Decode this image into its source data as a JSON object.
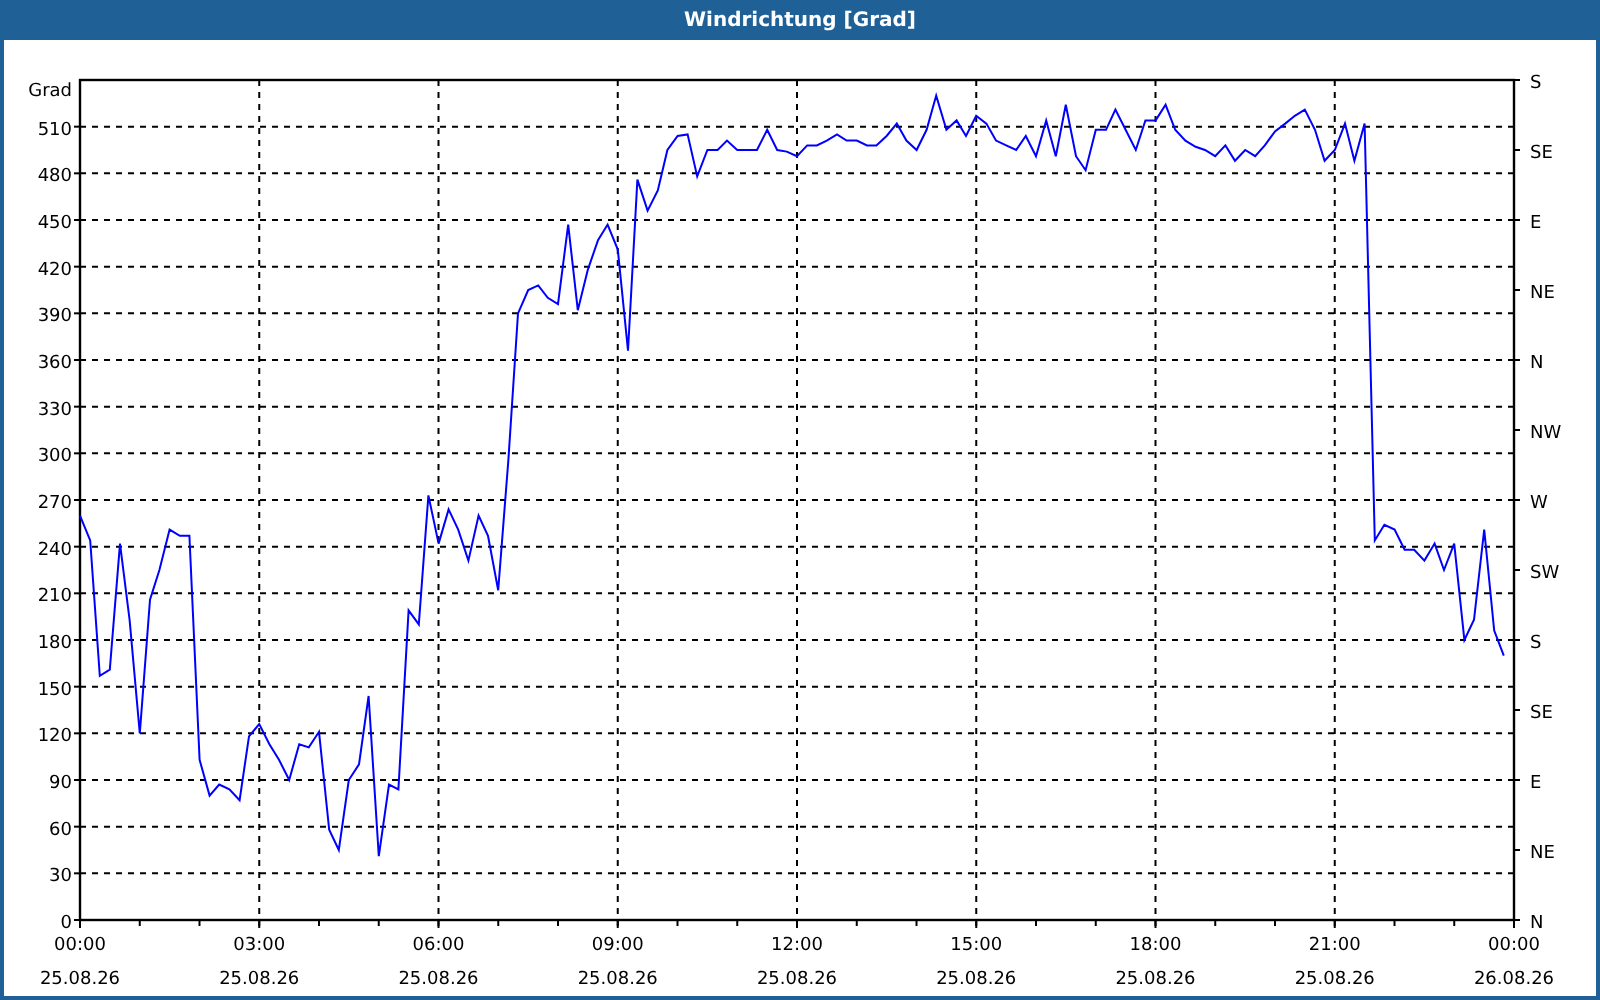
{
  "window": {
    "title": "Windrichtung [Grad]"
  },
  "compass_axis": [
    "S",
    "SE",
    "E",
    "NE",
    "N",
    "NW",
    "W",
    "SW",
    "S",
    "SE",
    "E",
    "NE",
    "N"
  ],
  "x_axis_dates": [
    "25.08.26",
    "25.08.26",
    "25.08.26",
    "25.08.26",
    "25.08.26",
    "25.08.26",
    "25.08.26",
    "25.08.26",
    "26.08.26"
  ],
  "chart_data": {
    "type": "line",
    "ylabel": "Grad",
    "xlim": [
      0,
      24
    ],
    "ylim": [
      0,
      540
    ],
    "grid": true,
    "yticks": [
      0,
      30,
      60,
      90,
      120,
      150,
      180,
      210,
      240,
      270,
      300,
      330,
      360,
      390,
      420,
      450,
      480,
      510
    ],
    "xticks": [
      {
        "value": 0,
        "label": "00:00"
      },
      {
        "value": 3,
        "label": "03:00"
      },
      {
        "value": 6,
        "label": "06:00"
      },
      {
        "value": 9,
        "label": "09:00"
      },
      {
        "value": 12,
        "label": "12:00"
      },
      {
        "value": 15,
        "label": "15:00"
      },
      {
        "value": 18,
        "label": "18:00"
      },
      {
        "value": 21,
        "label": "21:00"
      },
      {
        "value": 24,
        "label": "00:00"
      }
    ],
    "x": [
      0,
      0.17,
      0.33,
      0.5,
      0.67,
      0.83,
      1,
      1.17,
      1.33,
      1.5,
      1.67,
      1.83,
      2,
      2.17,
      2.33,
      2.5,
      2.67,
      2.83,
      3,
      3.17,
      3.33,
      3.5,
      3.67,
      3.83,
      4,
      4.17,
      4.33,
      4.5,
      4.67,
      4.83,
      5,
      5.17,
      5.33,
      5.5,
      5.67,
      5.83,
      6,
      6.17,
      6.33,
      6.5,
      6.67,
      6.83,
      7,
      7.17,
      7.33,
      7.5,
      7.67,
      7.83,
      8,
      8.17,
      8.33,
      8.5,
      8.67,
      8.83,
      9,
      9.17,
      9.33,
      9.5,
      9.67,
      9.83,
      10,
      10.17,
      10.33,
      10.5,
      10.67,
      10.83,
      11,
      11.17,
      11.33,
      11.5,
      11.67,
      11.83,
      12,
      12.17,
      12.33,
      12.5,
      12.67,
      12.83,
      13,
      13.17,
      13.33,
      13.5,
      13.67,
      13.83,
      14,
      14.17,
      14.33,
      14.5,
      14.67,
      14.83,
      15,
      15.17,
      15.33,
      15.5,
      15.67,
      15.83,
      16,
      16.17,
      16.33,
      16.5,
      16.67,
      16.83,
      17,
      17.17,
      17.33,
      17.5,
      17.67,
      17.83,
      18,
      18.17,
      18.33,
      18.5,
      18.67,
      18.83,
      19,
      19.17,
      19.33,
      19.5,
      19.67,
      19.83,
      20,
      20.17,
      20.33,
      20.5,
      20.67,
      20.83,
      21,
      21.17,
      21.33,
      21.5,
      21.67,
      21.83,
      22,
      22.17,
      22.33,
      22.5,
      22.67,
      22.83,
      23,
      23.17,
      23.33,
      23.5,
      23.67,
      23.83
    ],
    "series": [
      {
        "color": "#0000ff",
        "values": [
          260,
          244,
          157,
          161,
          242,
          193,
          120,
          206,
          225,
          251,
          247,
          247,
          103,
          80,
          87,
          84,
          77,
          118,
          126,
          113,
          103,
          90,
          113,
          111,
          121,
          58,
          45,
          90,
          100,
          144,
          41,
          87,
          84,
          199,
          190,
          273,
          242,
          264,
          251,
          231,
          260,
          247,
          212,
          296,
          390,
          405,
          408,
          400,
          396,
          447,
          392,
          418,
          437,
          447,
          431,
          366,
          476,
          456,
          469,
          495,
          504,
          505,
          478,
          495,
          495,
          501,
          495,
          495,
          495,
          508,
          495,
          494,
          491,
          498,
          498,
          501,
          505,
          501,
          501,
          498,
          498,
          504,
          512,
          501,
          495,
          508,
          530,
          508,
          514,
          504,
          517,
          512,
          501,
          498,
          495,
          504,
          491,
          514,
          491,
          524,
          491,
          482,
          508,
          508,
          521,
          508,
          495,
          514,
          514,
          524,
          508,
          501,
          497,
          495,
          491,
          498,
          488,
          495,
          491,
          498,
          507,
          512,
          517,
          521,
          508,
          488,
          495,
          512,
          488,
          512,
          244,
          254,
          251,
          238,
          238,
          231,
          242,
          225,
          242,
          180,
          193,
          251,
          186,
          170
        ]
      }
    ]
  }
}
